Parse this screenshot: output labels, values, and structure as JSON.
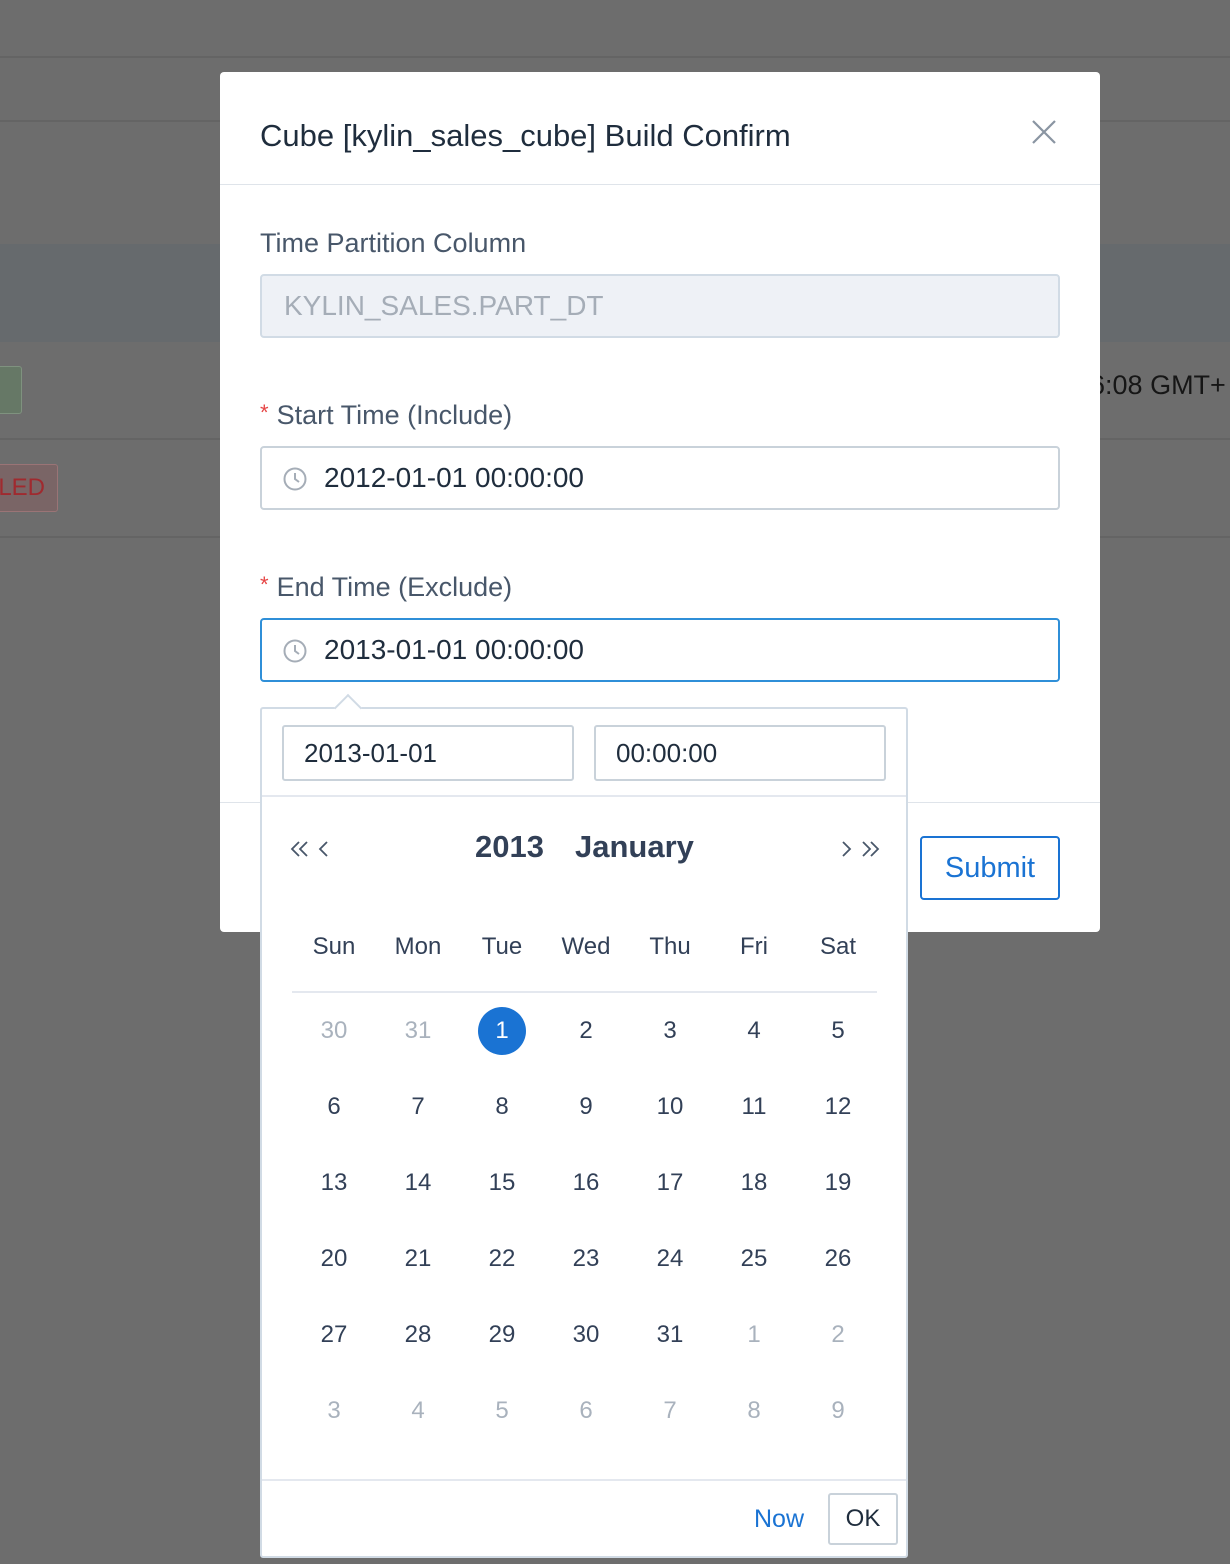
{
  "background": {
    "time_fragment": ":08 GMT+",
    "status_fragment": "LED"
  },
  "modal": {
    "title": "Cube [kylin_sales_cube] Build Confirm",
    "partition_label": "Time Partition Column",
    "partition_value": "KYLIN_SALES.PART_DT",
    "required_mark": "*",
    "start_label": "Start Time (Include)",
    "start_value": "2012-01-01 00:00:00",
    "end_label": "End Time (Exclude)",
    "end_value": "2013-01-01 00:00:00",
    "submit_label": "Submit"
  },
  "picker": {
    "date_value": "2013-01-01",
    "time_value": "00:00:00",
    "year": "2013",
    "month": "January",
    "weekdays": [
      "Sun",
      "Mon",
      "Tue",
      "Wed",
      "Thu",
      "Fri",
      "Sat"
    ],
    "weeks": [
      [
        {
          "d": "30",
          "m": 1
        },
        {
          "d": "31",
          "m": 1
        },
        {
          "d": "1",
          "s": 1
        },
        {
          "d": "2"
        },
        {
          "d": "3"
        },
        {
          "d": "4"
        },
        {
          "d": "5"
        }
      ],
      [
        {
          "d": "6"
        },
        {
          "d": "7"
        },
        {
          "d": "8"
        },
        {
          "d": "9"
        },
        {
          "d": "10"
        },
        {
          "d": "11"
        },
        {
          "d": "12"
        }
      ],
      [
        {
          "d": "13"
        },
        {
          "d": "14"
        },
        {
          "d": "15"
        },
        {
          "d": "16"
        },
        {
          "d": "17"
        },
        {
          "d": "18"
        },
        {
          "d": "19"
        }
      ],
      [
        {
          "d": "20"
        },
        {
          "d": "21"
        },
        {
          "d": "22"
        },
        {
          "d": "23"
        },
        {
          "d": "24"
        },
        {
          "d": "25"
        },
        {
          "d": "26"
        }
      ],
      [
        {
          "d": "27"
        },
        {
          "d": "28"
        },
        {
          "d": "29"
        },
        {
          "d": "30"
        },
        {
          "d": "31"
        },
        {
          "d": "1",
          "m": 1
        },
        {
          "d": "2",
          "m": 1
        }
      ],
      [
        {
          "d": "3",
          "m": 1
        },
        {
          "d": "4",
          "m": 1
        },
        {
          "d": "5",
          "m": 1
        },
        {
          "d": "6",
          "m": 1
        },
        {
          "d": "7",
          "m": 1
        },
        {
          "d": "8",
          "m": 1
        },
        {
          "d": "9",
          "m": 1
        }
      ]
    ],
    "now_label": "Now",
    "ok_label": "OK",
    "accent_color": "#1a73d3"
  },
  "icons": {
    "close": "close-icon",
    "clock": "clock-icon",
    "prev_year": "double-chevron-left-icon",
    "prev_month": "chevron-left-icon",
    "next_month": "chevron-right-icon",
    "next_year": "double-chevron-right-icon"
  }
}
